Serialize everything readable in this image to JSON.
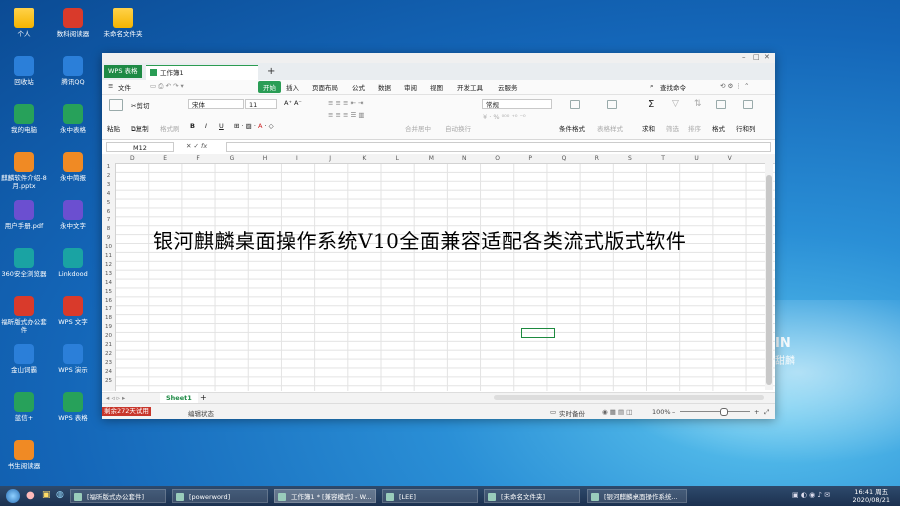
{
  "desktop": {
    "brand_main": "IN",
    "brand_sub": "甜麟",
    "icons_col1": [
      {
        "label": "个人",
        "icon": "folder-icon"
      },
      {
        "label": "回收站",
        "icon": "trash-icon"
      },
      {
        "label": "我的电脑",
        "icon": "computer-icon"
      },
      {
        "label": "麒麟软件介绍-8月.pptx",
        "icon": "pptx-file-icon"
      },
      {
        "label": "用户手册.pdf",
        "icon": "pdf-file-icon"
      },
      {
        "label": "360安全浏览器",
        "icon": "browser-icon"
      },
      {
        "label": "福昕版式办公套件",
        "icon": "foxit-icon"
      },
      {
        "label": "金山词霸",
        "icon": "dictionary-icon"
      },
      {
        "label": "蓝信+",
        "icon": "lanxin-icon"
      },
      {
        "label": "书生阅读器",
        "icon": "ofd-reader-icon"
      }
    ],
    "icons_col2": [
      {
        "label": "数科阅读器",
        "icon": "reader-icon"
      },
      {
        "label": "腾讯QQ",
        "icon": "qq-icon"
      },
      {
        "label": "永中表格",
        "icon": "yozo-sheet-icon"
      },
      {
        "label": "永中简报",
        "icon": "yozo-ppt-icon"
      },
      {
        "label": "永中文字",
        "icon": "yozo-word-icon"
      },
      {
        "label": "Linkdood",
        "icon": "linkdood-icon"
      },
      {
        "label": "WPS 文字",
        "icon": "wps-writer-icon"
      },
      {
        "label": "WPS 演示",
        "icon": "wps-present-icon"
      },
      {
        "label": "WPS 表格",
        "icon": "wps-sheet-icon"
      }
    ],
    "icons_col3": [
      {
        "label": "未命名文件夹",
        "icon": "folder-icon"
      }
    ]
  },
  "window": {
    "app_tab": "WPS 表格",
    "doc_tab": "工作簿1",
    "new_tab": "+",
    "menu": {
      "file": "文件",
      "items": [
        "开始",
        "插入",
        "页面布局",
        "公式",
        "数据",
        "审阅",
        "视图",
        "开发工具",
        "云服务"
      ],
      "search": "查找命令"
    },
    "toolbar": {
      "paste": "粘贴",
      "cut": "剪切",
      "copy": "复制",
      "format_painter": "格式刷",
      "font": "宋体",
      "size": "11",
      "bold": "B",
      "italic": "I",
      "underline": "U",
      "merge": "合并居中",
      "wrap": "自动换行",
      "number_format": "常规",
      "cond_format": "条件格式",
      "table_style": "表格样式",
      "sum": "求和",
      "filter": "筛选",
      "sort": "排序",
      "format": "格式",
      "rowcol": "行和列"
    },
    "name_box": "M12",
    "columns": [
      "D",
      "E",
      "F",
      "G",
      "H",
      "I",
      "J",
      "K",
      "L",
      "M",
      "N",
      "O",
      "P",
      "Q",
      "R",
      "S",
      "T",
      "U",
      "V"
    ],
    "rows": [
      "1",
      "2",
      "3",
      "4",
      "5",
      "6",
      "7",
      "8",
      "9",
      "10",
      "11",
      "12",
      "13",
      "14",
      "15",
      "16",
      "17",
      "18",
      "19",
      "20",
      "21",
      "22",
      "23",
      "24",
      "25"
    ],
    "cell_text": "银河麒麟桌面操作系统V10全面兼容适配各类流式版式软件",
    "sheet_tab": "Sheet1",
    "status": {
      "trial": "剩余272天试用",
      "mode": "编辑状态",
      "backup": "实时备份",
      "zoom": "100%",
      "zoom_fraction": 0.55
    }
  },
  "taskbar": {
    "tasks": [
      {
        "label": "[福昕版式办公套件]"
      },
      {
        "label": "[powerword]"
      },
      {
        "label": "工作簿1 * [兼容模式] - W..."
      },
      {
        "label": "[LEE]"
      },
      {
        "label": "[未命名文件夹]"
      },
      {
        "label": "[银河麒麟桌面操作系统..."
      }
    ],
    "time": "16:41 周五",
    "date": "2020/08/21"
  }
}
